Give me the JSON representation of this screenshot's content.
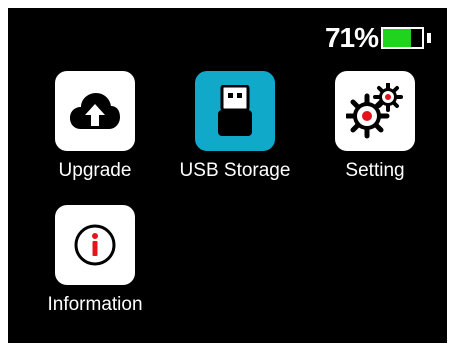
{
  "status": {
    "battery_percent_label": "71%",
    "battery_level": 0.71,
    "battery_color": "#1fd31f"
  },
  "apps": [
    {
      "label": "Upgrade",
      "icon": "cloud-upload-icon"
    },
    {
      "label": "USB Storage",
      "icon": "usb-drive-icon",
      "selected": true,
      "accent": "#11a9c9"
    },
    {
      "label": "Setting",
      "icon": "gears-icon"
    },
    {
      "label": "Information",
      "icon": "info-icon"
    }
  ]
}
